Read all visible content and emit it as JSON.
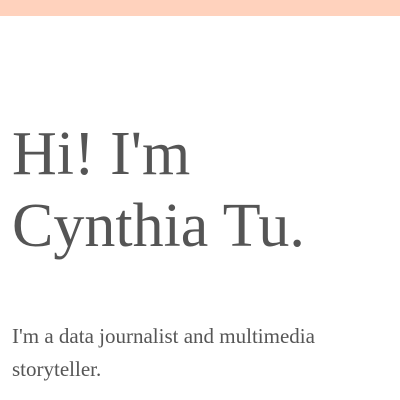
{
  "theme": {
    "top_bar_color": "#ffd2bd",
    "text_color": "#555555",
    "background_color": "#ffffff"
  },
  "hero": {
    "title_line_1": "Hi! I'm",
    "title_line_2": "Cynthia Tu.",
    "subtitle_line_1": "I'm a data journalist and multimedia",
    "subtitle_line_2": "storyteller."
  }
}
